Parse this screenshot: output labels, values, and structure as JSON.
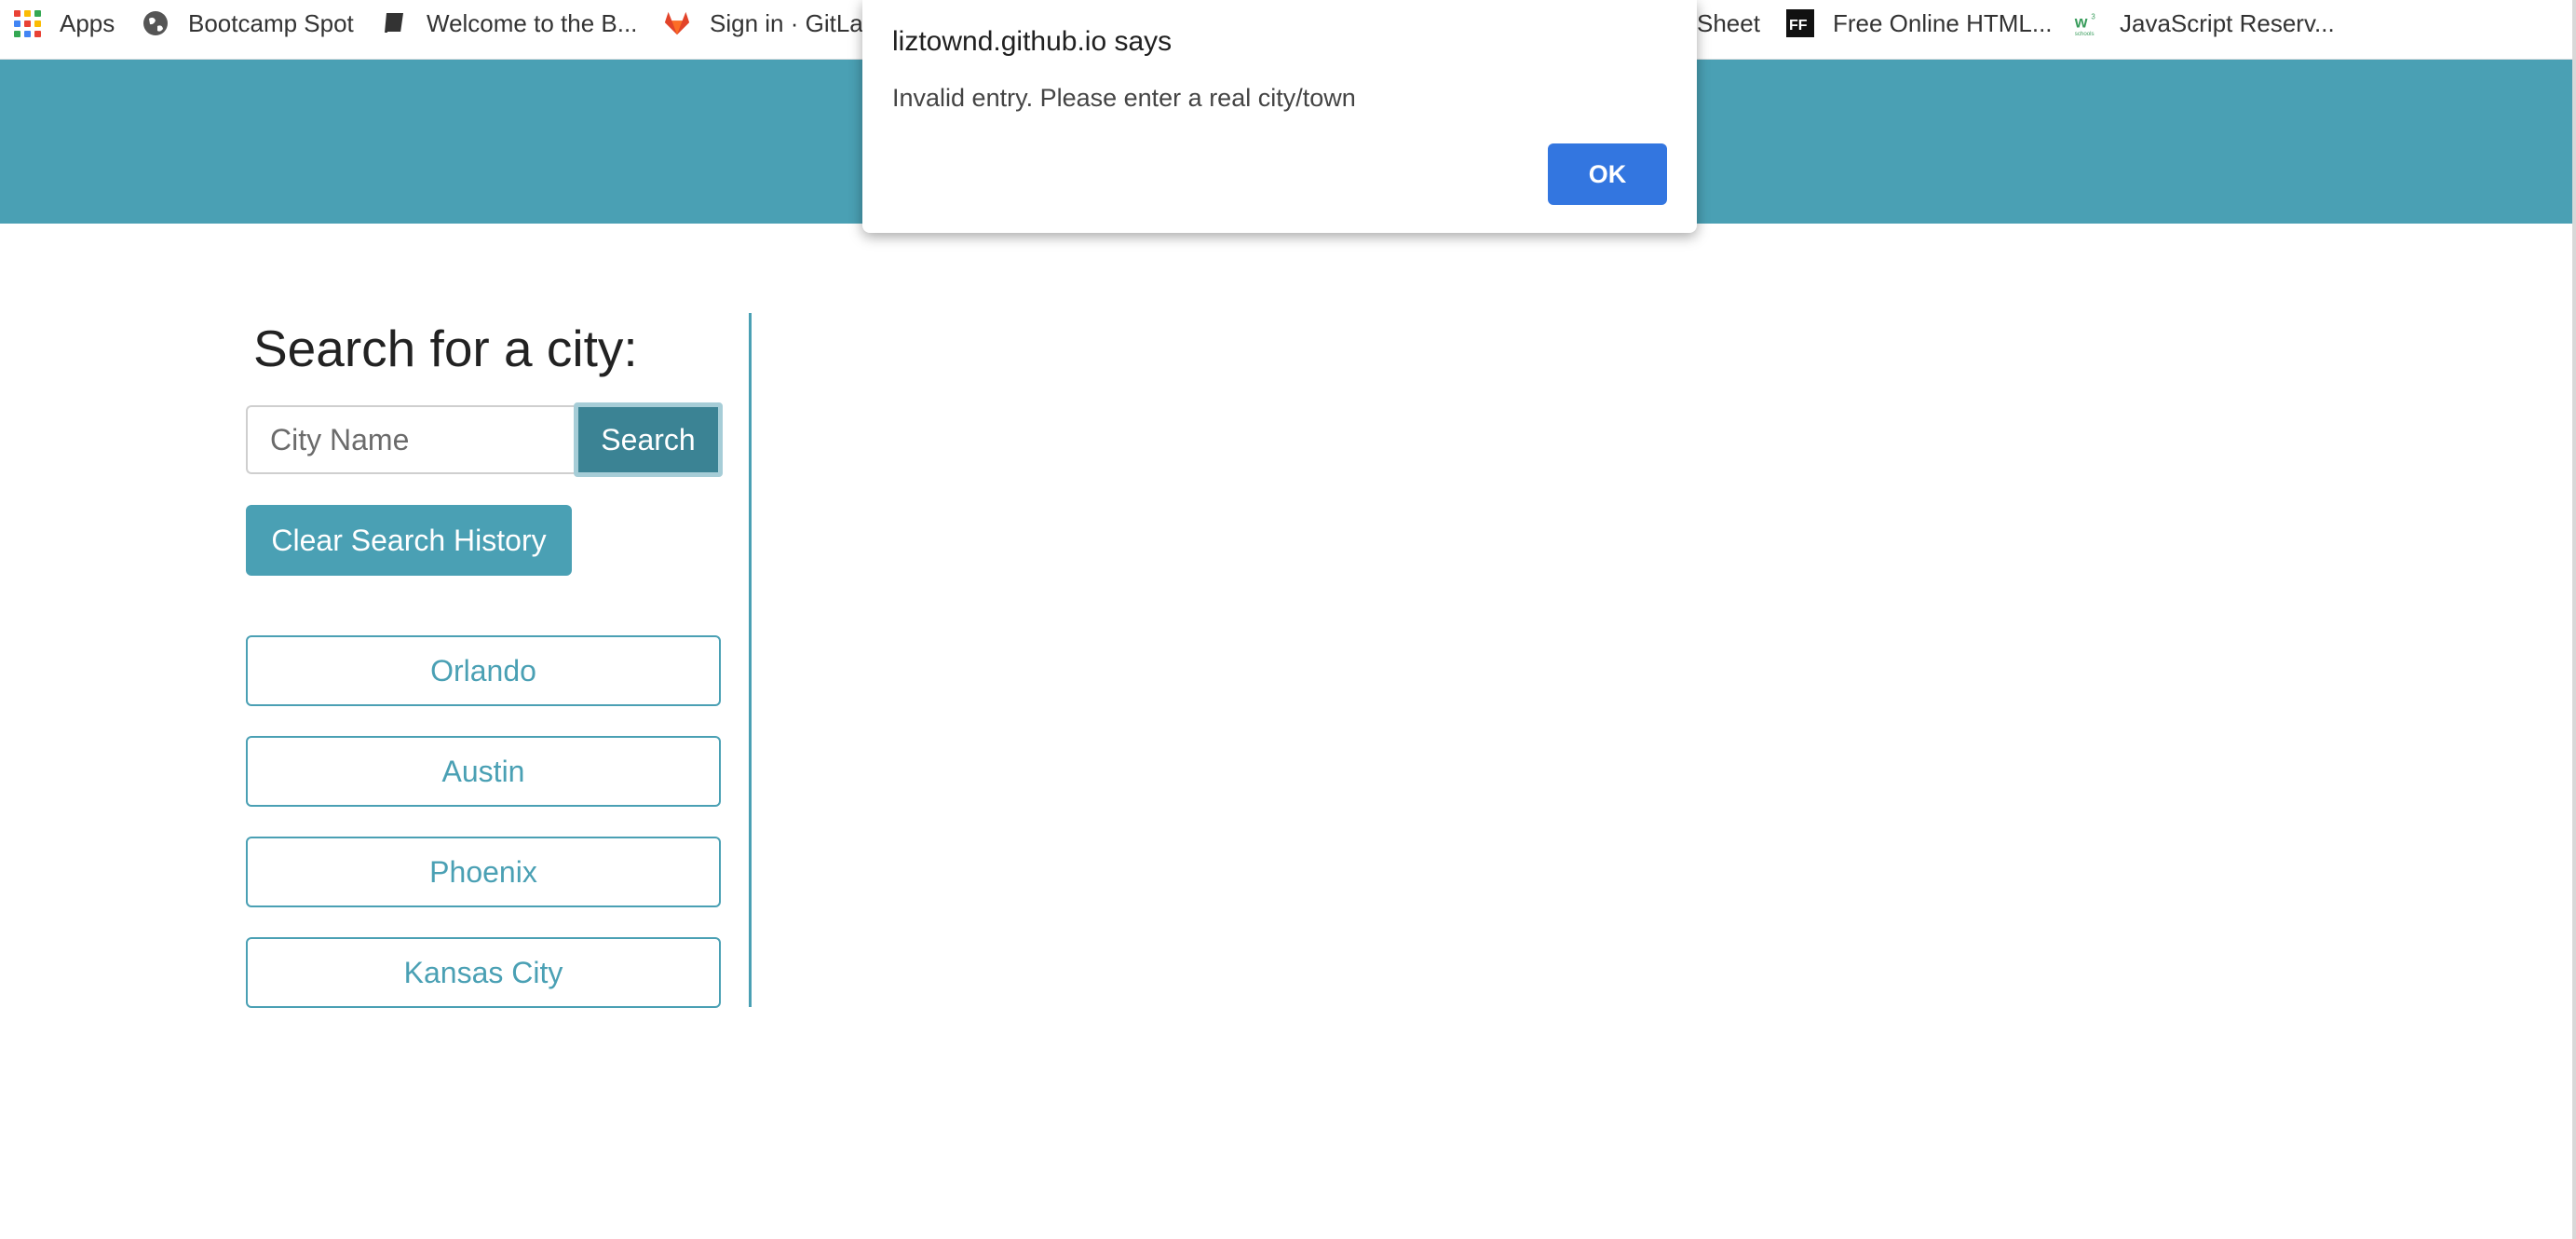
{
  "bookmarks": [
    {
      "label": "Apps",
      "icon": "apps-grid-icon"
    },
    {
      "label": "Bootcamp Spot",
      "icon": "globe-icon"
    },
    {
      "label": "Welcome to the B...",
      "icon": "book-icon"
    },
    {
      "label": "Sign in · GitLab",
      "icon": "gitlab-icon"
    },
    {
      "label": "Sheet",
      "icon": ""
    },
    {
      "label": "Free Online HTML...",
      "icon": "ff-icon"
    },
    {
      "label": "JavaScript Reserv...",
      "icon": "w3schools-icon"
    }
  ],
  "colors": {
    "accent": "#4aa0b4",
    "search_button": "#3b8394",
    "ok_button": "#3376e0"
  },
  "sidebar": {
    "title": "Search for a city:",
    "input_placeholder": "City Name",
    "search_label": "Search",
    "clear_label": "Clear Search History",
    "history": [
      "Orlando",
      "Austin",
      "Phoenix",
      "Kansas City"
    ]
  },
  "alert": {
    "title": "liztownd.github.io says",
    "message": "Invalid entry. Please enter a real city/town",
    "ok_label": "OK"
  }
}
